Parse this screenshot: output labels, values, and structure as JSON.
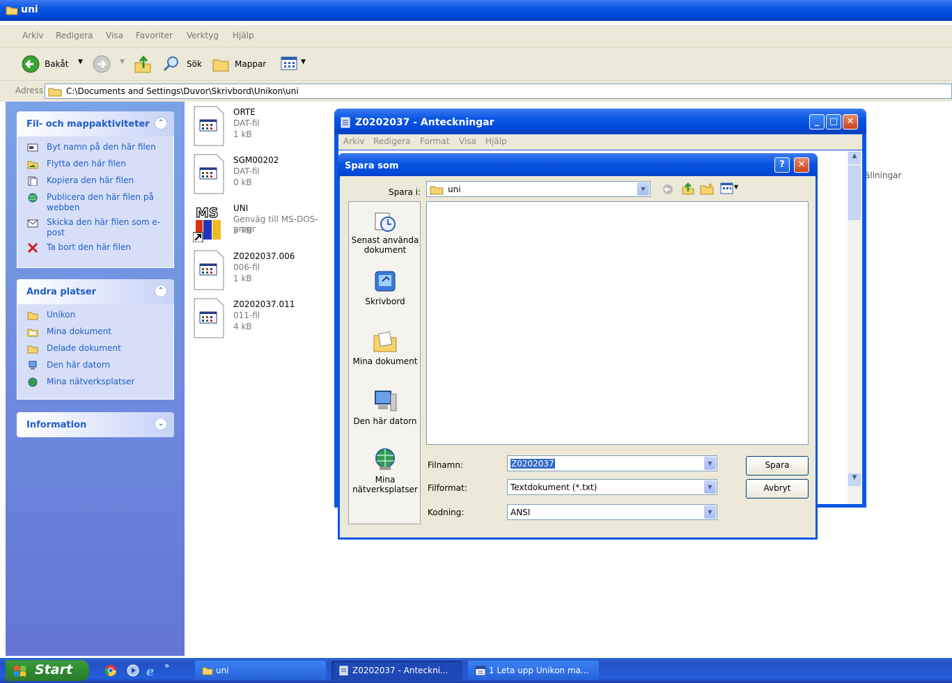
{
  "explorer": {
    "title": "uni",
    "menu": [
      "Arkiv",
      "Redigera",
      "Visa",
      "Favoriter",
      "Verktyg",
      "Hjälp"
    ],
    "toolbar": {
      "back": "Bakåt",
      "search": "Sök",
      "folders": "Mappar"
    },
    "address_label": "Adress",
    "address_value": "C:\\Documents and Settings\\Duvor\\Skrivbord\\Unikon\\uni",
    "partial_text": "ällningar"
  },
  "taskpane": {
    "file_tasks": {
      "title": "Fil- och mappaktiviteter",
      "items": [
        "Byt namn på den här filen",
        "Flytta den här filen",
        "Kopiera den här filen",
        "Publicera den här filen på webben",
        "Skicka den här filen som e-post",
        "Ta bort den här filen"
      ]
    },
    "other_places": {
      "title": "Andra platser",
      "items": [
        "Unikon",
        "Mina dokument",
        "Delade dokument",
        "Den här datorn",
        "Mina nätverksplatser"
      ]
    },
    "information": {
      "title": "Information"
    }
  },
  "files": [
    {
      "name": "ORTE",
      "type": "DAT-fil",
      "size": "1 kB"
    },
    {
      "name": "SGM00202",
      "type": "DAT-fil",
      "size": "0 kB"
    },
    {
      "name": "UNI",
      "type": "Genväg till MS-DOS-progr",
      "size": "3 kB"
    },
    {
      "name": "Z0202037.006",
      "type": "006-fil",
      "size": "1 kB"
    },
    {
      "name": "Z0202037.011",
      "type": "011-fil",
      "size": "4 kB"
    }
  ],
  "notepad": {
    "title": "Z0202037 - Anteckningar",
    "menu": [
      "Arkiv",
      "Redigera",
      "Format",
      "Visa",
      "Hjälp"
    ]
  },
  "save_dialog": {
    "title": "Spara som",
    "save_in_label": "Spara i:",
    "save_in_value": "uni",
    "places": [
      "Senast använda dokument",
      "Skrivbord",
      "Mina dokument",
      "Den här datorn",
      "Mina nätverksplatser"
    ],
    "filename_label": "Filnamn:",
    "filename_value": "Z0202037",
    "format_label": "Filformat:",
    "format_value": "Textdokument (*.txt)",
    "encoding_label": "Kodning:",
    "encoding_value": "ANSI",
    "save_button": "Spara",
    "cancel_button": "Avbryt"
  },
  "taskbar": {
    "start": "Start",
    "buttons": [
      "uni",
      "Z0202037 - Anteckni...",
      "1 Leta upp Unikon ma..."
    ]
  },
  "colors": {
    "xp_blue": "#0a56e2",
    "taskpane_blue": "#6375d6",
    "link_blue": "#215dc6",
    "start_green": "#2f8a2f",
    "dialog_face": "#ece9d8"
  }
}
